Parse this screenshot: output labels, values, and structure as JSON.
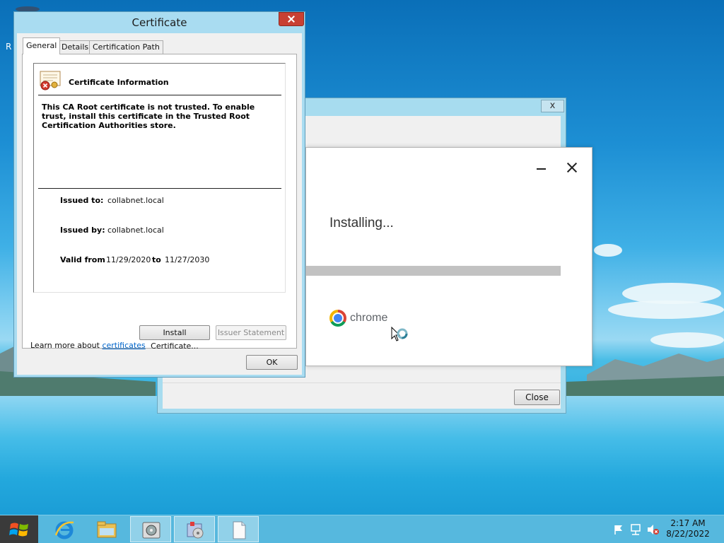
{
  "desktop": {
    "edge_text": "R"
  },
  "cert": {
    "title": "Certificate",
    "tabs": [
      "General",
      "Details",
      "Certification Path"
    ],
    "info_heading": "Certificate Information",
    "warning": "This CA Root certificate is not trusted. To enable trust, install this certificate in the Trusted Root Certification Authorities store.",
    "issued_to_label": "Issued to:",
    "issued_to": "collabnet.local",
    "issued_by_label": "Issued by:",
    "issued_by": "collabnet.local",
    "valid_from_label": "Valid from",
    "valid_from": "11/29/2020",
    "to_label": "to",
    "valid_to": "11/27/2030",
    "install_button": "Install Certificate...",
    "issuer_button": "Issuer Statement",
    "learn_more_prefix": "Learn more about ",
    "learn_more_link": "certificates",
    "ok_button": "OK"
  },
  "installer_window": {
    "close_x": "x",
    "close_button": "Close"
  },
  "chrome_popup": {
    "status": "Installing...",
    "progress": 0.0,
    "brand": "chrome"
  },
  "taskbar": {
    "time": "2:17 AM",
    "date": "8/22/2022"
  },
  "colors": {
    "taskbar": "#56b8de",
    "cert_frame": "#a9dcf1",
    "close_red": "#c84033",
    "link": "#0066cc"
  }
}
